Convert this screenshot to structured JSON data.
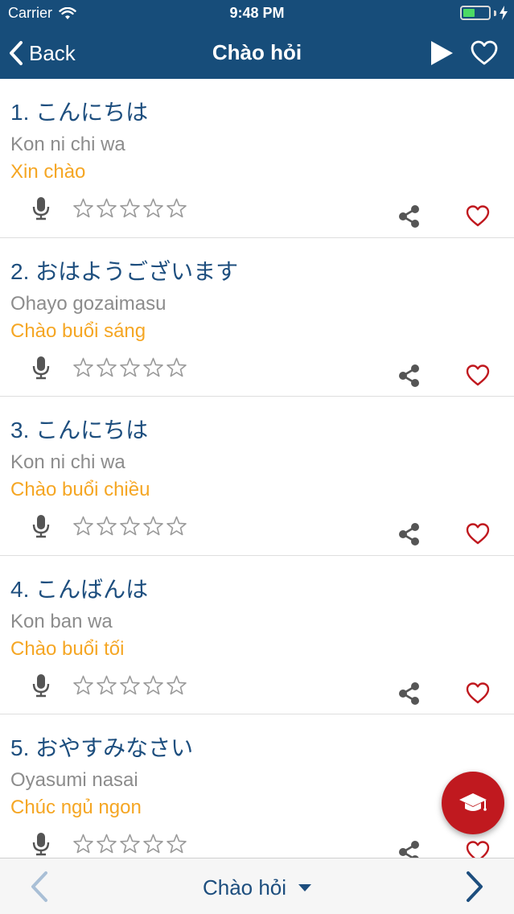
{
  "status_bar": {
    "carrier": "Carrier",
    "time": "9:48 PM"
  },
  "nav": {
    "back_label": "Back",
    "title": "Chào hỏi"
  },
  "phrases": [
    {
      "number": "1.",
      "japanese": "1. こんにちは",
      "romaji": "Kon ni chi wa",
      "meaning": "Xin chào",
      "rating": 0
    },
    {
      "number": "2.",
      "japanese": "2. おはようございます",
      "romaji": "Ohayo gozaimasu",
      "meaning": "Chào buổi sáng",
      "rating": 0
    },
    {
      "number": "3.",
      "japanese": "3. こんにちは",
      "romaji": "Kon ni chi wa",
      "meaning": "Chào buổi chiều",
      "rating": 0
    },
    {
      "number": "4.",
      "japanese": "4. こんばんは",
      "romaji": "Kon ban wa",
      "meaning": "Chào buổi tối",
      "rating": 0
    },
    {
      "number": "5.",
      "japanese": "5. おやすみなさい",
      "romaji": "Oyasumi nasai",
      "meaning": "Chúc ngủ ngon",
      "rating": 0
    }
  ],
  "bottom_bar": {
    "topic_label": "Chào hỏi"
  },
  "colors": {
    "header_bg": "#174d7a",
    "japanese_text": "#1d4e7e",
    "romaji_text": "#8c8c8c",
    "meaning_text": "#f5a623",
    "favorite_heart": "#c0191f",
    "fab_bg": "#c0191f"
  },
  "icons": {
    "back": "chevron-left-icon",
    "play": "play-icon",
    "favorite": "heart-icon",
    "microphone": "microphone-icon",
    "rating": "star-outline-icon",
    "share": "share-icon",
    "fab": "graduation-cap-icon",
    "prev": "chevron-left-icon",
    "next": "chevron-right-icon",
    "dropdown": "caret-down-icon"
  }
}
